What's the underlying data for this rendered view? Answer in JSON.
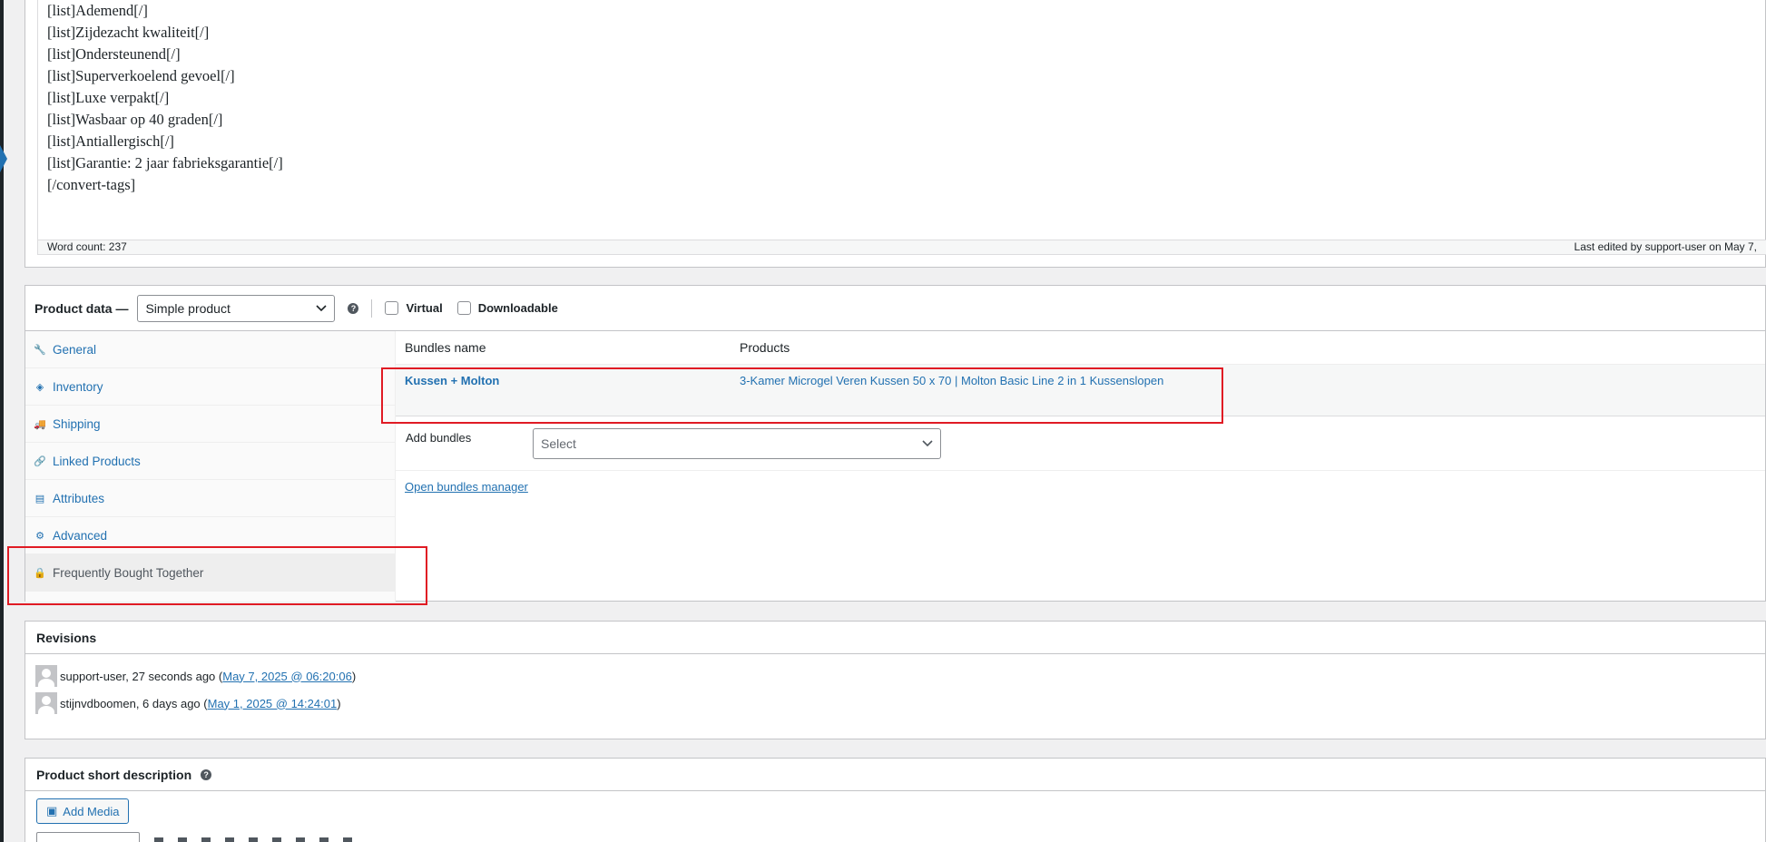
{
  "editor": {
    "lines": [
      "[list]Ademend[/]",
      "[list]Zijdezacht kwaliteit[/]",
      "[list]Ondersteunend[/]",
      "[list]Superverkoelend gevoel[/]",
      "[list]Luxe verpakt[/]",
      "[list]Wasbaar op 40 graden[/]",
      "[list]Antiallergisch[/]",
      "[list]Garantie: 2 jaar fabrieksgarantie[/]",
      "[/convert-tags]"
    ],
    "word_count": "Word count: 237",
    "last_edited": "Last edited by support-user on May 7,"
  },
  "product_data": {
    "title": "Product data —",
    "type_select": "Simple product",
    "help": "?",
    "virtual_label": "Virtual",
    "downloadable_label": "Downloadable",
    "tabs": [
      {
        "label": "General",
        "icon": "wrench-icon",
        "glyph": "🔧"
      },
      {
        "label": "Inventory",
        "icon": "tag-icon",
        "glyph": "◈"
      },
      {
        "label": "Shipping",
        "icon": "truck-icon",
        "glyph": "🚚"
      },
      {
        "label": "Linked Products",
        "icon": "link-icon",
        "glyph": "🔗"
      },
      {
        "label": "Attributes",
        "icon": "list-icon",
        "glyph": "▤"
      },
      {
        "label": "Advanced",
        "icon": "gear-icon",
        "glyph": "⚙"
      },
      {
        "label": "Frequently Bought Together",
        "icon": "bag-icon",
        "glyph": "🔒"
      }
    ],
    "bundles": {
      "col_name": "Bundles name",
      "col_products": "Products",
      "rows": [
        {
          "name": "Kussen + Molton",
          "products": "3-Kamer Microgel Veren Kussen 50 x 70 | Molton Basic Line 2 in 1 Kussenslopen"
        }
      ],
      "add_label": "Add bundles",
      "select_placeholder": "Select",
      "manager_link": "Open bundles manager"
    }
  },
  "revisions": {
    "title": "Revisions",
    "items": [
      {
        "text": "support-user, 27 seconds ago (",
        "link": "May 7, 2025 @ 06:20:06",
        "close": ")"
      },
      {
        "text": "stijnvdboomen, 6 days ago (",
        "link": "May 1, 2025 @ 14:24:01",
        "close": ")"
      }
    ]
  },
  "short_description": {
    "title": "Product short description",
    "help": "?",
    "add_media": "Add Media"
  },
  "colors": {
    "accent": "#2271b1",
    "highlight": "#e01b24"
  }
}
